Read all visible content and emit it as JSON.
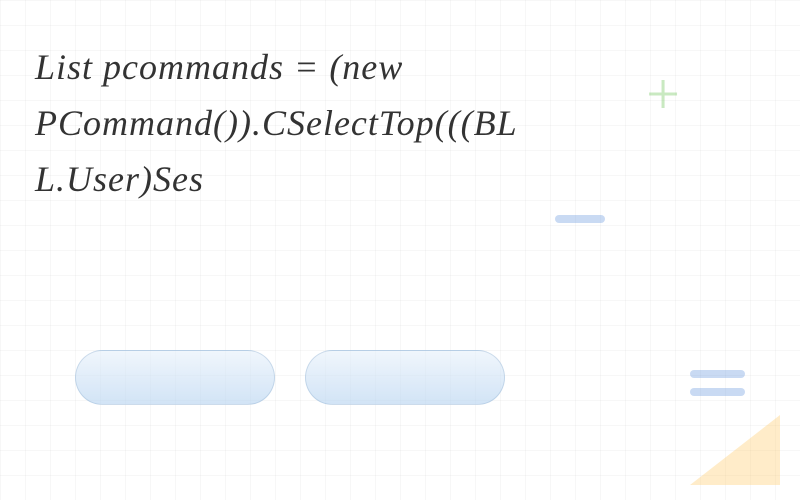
{
  "code_text": "List pcommands = (new PCommand()).CSelectTop(((BLL.User)Ses",
  "icons": {
    "plus": "+",
    "minus": "−"
  }
}
